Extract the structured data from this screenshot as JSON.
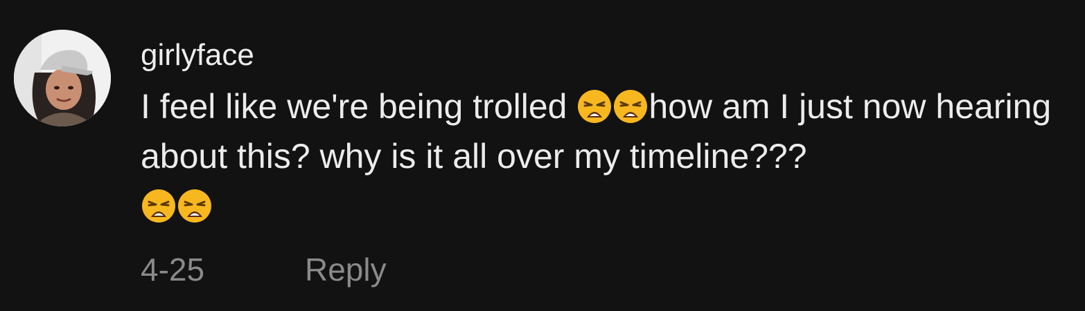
{
  "comment": {
    "username": "girlyface",
    "text_part1": "I feel like we're being trolled ",
    "emoji_1": "😩",
    "emoji_2": "😩",
    "text_part2": "how am I just now hearing about this? why is it all over my timeline???",
    "emoji_3": "😩",
    "emoji_4": "😩",
    "emoji_icon": "weary-face-icon",
    "date": "4-25",
    "reply_label": "Reply"
  },
  "colors": {
    "background": "#121212",
    "text": "#ececec",
    "meta": "#8a8a8a",
    "emoji_face": "#f7b71f"
  }
}
